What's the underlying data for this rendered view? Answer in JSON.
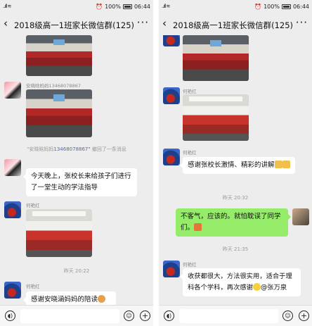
{
  "status_bar": {
    "signal": "..ıll ≋",
    "battery_pct": "100%",
    "time": "06:44"
  },
  "chat": {
    "title": "2018级高一1班家长微信群(125)"
  },
  "left": {
    "sender1": "安晓晗妈妈13468078867",
    "recall_name": "\"安晓晗妈妈",
    "recall_phone": "13468078867\"",
    "recall_text": "撤回了一条消息",
    "msg1": "今天晚上，张校长来给孩子们进行了一堂生动的学法指导",
    "sender2": "何艳红",
    "time1": "昨天 20:22",
    "sender3": "何艳红",
    "msg2": "感谢安晓涵妈妈的陪读"
  },
  "right": {
    "sender1": "何艳红",
    "sender2": "何艳红",
    "msg1": "感谢张校长激情、精彩的讲解",
    "time1": "昨天 20:32",
    "msg_me": "不客气，应该的。就怕耽误了同学们。",
    "time2": "昨天 21:35",
    "sender3": "何艳红",
    "msg2": "收获都很大，方法很实用，适合于理科各个学科，再次感谢",
    "msg2_tail": "张万泉"
  },
  "colors": {
    "self_bubble": "#95ec69",
    "bubble": "#ffffff",
    "bg": "#ededed",
    "link": "#576b95"
  },
  "icons": [
    "back-arrow-icon",
    "more-icon",
    "voice-icon",
    "emoji-icon",
    "plus-icon",
    "wifi-icon",
    "alarm-icon",
    "battery-icon"
  ]
}
